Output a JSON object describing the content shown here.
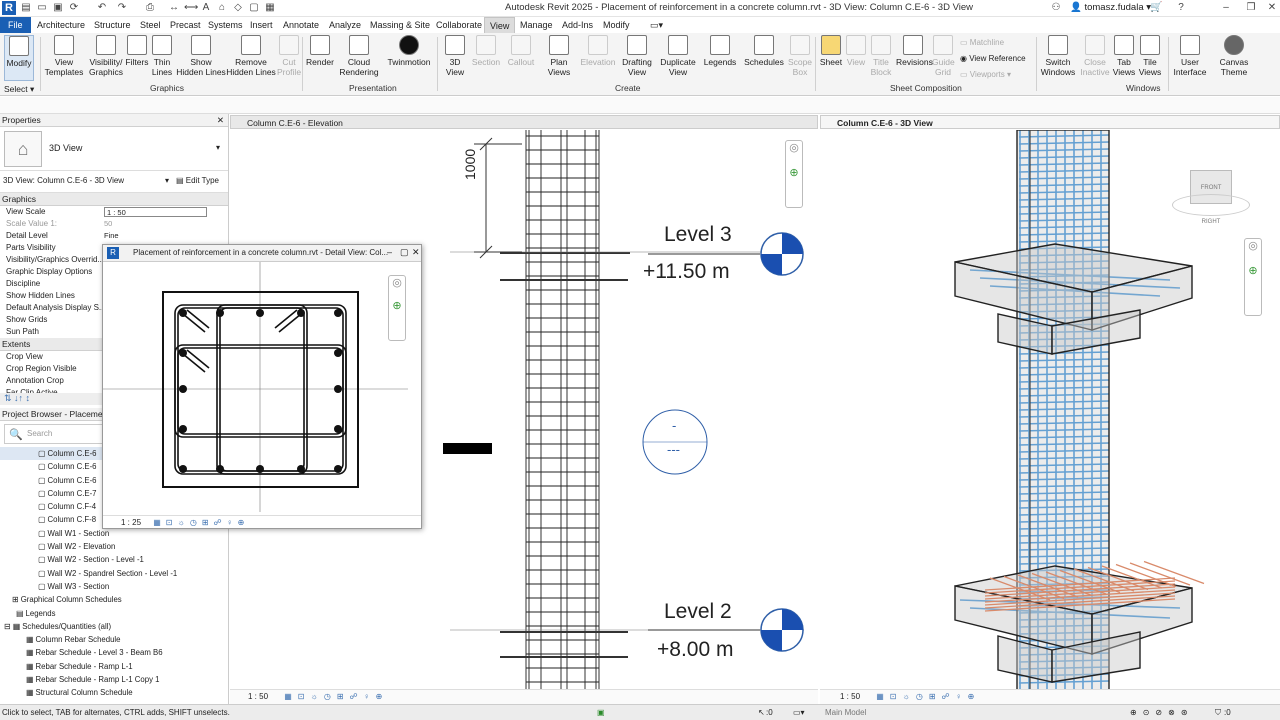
{
  "app_title": "Autodesk Revit 2025 - Placement of reinforcement in a concrete column.rvt - 3D View: Column C.E-6 - 3D View",
  "user": "tomasz.fudala",
  "menu": [
    "File",
    "Architecture",
    "Structure",
    "Steel",
    "Precast",
    "Systems",
    "Insert",
    "Annotate",
    "Analyze",
    "Massing & Site",
    "Collaborate",
    "View",
    "Manage",
    "Add-Ins",
    "Modify"
  ],
  "ribbon": {
    "select_label": "Select",
    "panels": [
      "Graphics",
      "Presentation",
      "Create",
      "Sheet Composition",
      "Windows"
    ],
    "buttons": [
      {
        "label": "Modify",
        "icon": "cursor-icon"
      },
      {
        "label": "View Templates",
        "icon": "view-templates-icon"
      },
      {
        "label": "Visibility/ Graphics",
        "icon": "visibility-graphics-icon"
      },
      {
        "label": "Filters",
        "icon": "filters-icon"
      },
      {
        "label": "Thin Lines",
        "icon": "thin-lines-icon"
      },
      {
        "label": "Show Hidden Lines",
        "icon": "show-hidden-lines-icon"
      },
      {
        "label": "Remove Hidden Lines",
        "icon": "remove-hidden-lines-icon"
      },
      {
        "label": "Cut Profile",
        "icon": "cut-profile-icon"
      },
      {
        "label": "Render",
        "icon": "render-teapot-icon"
      },
      {
        "label": "Cloud Rendering",
        "icon": "cloud-rendering-icon"
      },
      {
        "label": "Twinmotion",
        "icon": "twinmotion-icon"
      },
      {
        "label": "3D View",
        "icon": "house-3d-icon"
      },
      {
        "label": "Section",
        "icon": "section-icon"
      },
      {
        "label": "Callout",
        "icon": "callout-icon"
      },
      {
        "label": "Plan Views",
        "icon": "plan-views-icon"
      },
      {
        "label": "Elevation",
        "icon": "elevation-icon"
      },
      {
        "label": "Drafting View",
        "icon": "drafting-view-icon"
      },
      {
        "label": "Duplicate View",
        "icon": "duplicate-view-icon"
      },
      {
        "label": "Legends",
        "icon": "legends-icon"
      },
      {
        "label": "Schedules",
        "icon": "schedules-icon"
      },
      {
        "label": "Scope Box",
        "icon": "scope-box-icon"
      },
      {
        "label": "Sheet",
        "icon": "sheet-icon"
      },
      {
        "label": "View",
        "icon": "view-icon"
      },
      {
        "label": "Title Block",
        "icon": "title-block-icon"
      },
      {
        "label": "Revisions",
        "icon": "revisions-icon"
      },
      {
        "label": "Guide Grid",
        "icon": "guide-grid-icon"
      },
      {
        "label": "Switch Windows",
        "icon": "switch-windows-icon"
      },
      {
        "label": "Close Inactive",
        "icon": "close-inactive-icon"
      },
      {
        "label": "Tab Views",
        "icon": "tab-views-icon"
      },
      {
        "label": "Tile Views",
        "icon": "tile-views-icon"
      },
      {
        "label": "User Interface",
        "icon": "user-interface-icon"
      },
      {
        "label": "Canvas Theme",
        "icon": "canvas-theme-icon"
      }
    ],
    "small": [
      "Matchline",
      "View Reference",
      "Viewports"
    ]
  },
  "properties": {
    "title": "Properties",
    "type_name": "3D View",
    "selector": "3D View: Column C.E-6 - 3D View",
    "edit_type": "Edit Type",
    "groups": [
      "Graphics",
      "Extents"
    ],
    "rows_graphics": [
      {
        "name": "View Scale",
        "value": "1 : 50"
      },
      {
        "name": "Scale Value    1:",
        "value": "50"
      },
      {
        "name": "Detail Level",
        "value": "Fine"
      },
      {
        "name": "Parts Visibility",
        "value": ""
      },
      {
        "name": "Visibility/Graphics Overrid...",
        "value": ""
      },
      {
        "name": "Graphic Display Options",
        "value": ""
      },
      {
        "name": "Discipline",
        "value": ""
      },
      {
        "name": "Show Hidden Lines",
        "value": ""
      },
      {
        "name": "Default Analysis Display S...",
        "value": ""
      },
      {
        "name": "Show Grids",
        "value": ""
      },
      {
        "name": "Sun Path",
        "value": ""
      }
    ],
    "rows_extents": [
      "Crop View",
      "Crop Region Visible",
      "Annotation Crop",
      "Far Clip Active"
    ]
  },
  "browser": {
    "title": "Project Browser - Placement",
    "search": "Search",
    "items": [
      "Column C.E-6",
      "Column C.E-6",
      "Column C.E-6",
      "Column C.E-7",
      "Column C.F-4",
      "Column C.F-8",
      "Wall W1 - Section",
      "Wall W2 - Elevation",
      "Wall W2 - Section - Level -1",
      "Wall W2 - Spandrel Section - Level -1",
      "Wall W3 - Section",
      "Graphical Column Schedules",
      "Legends",
      "Schedules/Quantities (all)",
      "Column Rebar Schedule",
      "Rebar Schedule - Level 3 - Beam B6",
      "Rebar Schedule - Ramp L-1",
      "Rebar Schedule - Ramp L-1 Copy 1",
      "Structural Column Schedule"
    ]
  },
  "views": {
    "elevation_tab": "Column C.E-6 - Elevation",
    "threed_tab": "Column C.E-6 - 3D View",
    "detail_title": "Placement of reinforcement in a concrete column.rvt - Detail View: Col...",
    "detail_scale": "1 : 25",
    "elev_scale": "1 : 50",
    "threed_scale": "1 : 50",
    "dimension": "1000",
    "level3_name": "Level 3",
    "level3_elev": "+11.50 m",
    "level2_name": "Level 2",
    "level2_elev": "+8.00 m",
    "tag_top": "-",
    "tag_bottom": "---",
    "viewcube_front": "FRONT",
    "viewcube_right": "RIGHT"
  },
  "status": {
    "hint": "Click to select, TAB for alternates, CTRL adds, SHIFT unselects.",
    "zero": ":0",
    "model": "Main Model",
    "filter": ":0"
  }
}
